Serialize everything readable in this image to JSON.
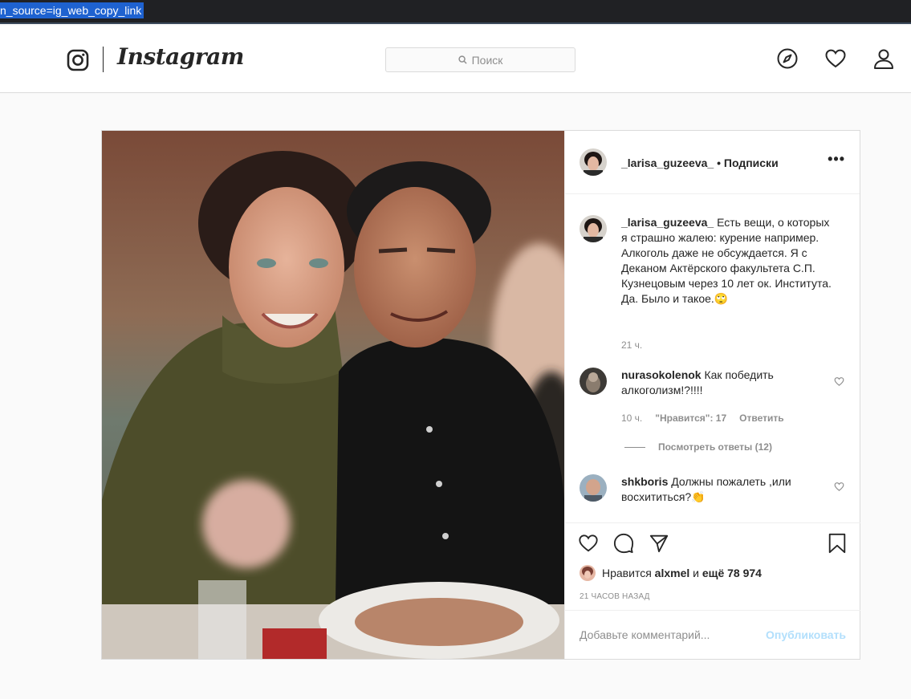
{
  "browser": {
    "url_fragment": "n_source=ig_web_copy_link"
  },
  "nav": {
    "wordmark": "Instagram",
    "search_placeholder": "Поиск",
    "icons": [
      "explore-icon",
      "heart-icon",
      "profile-icon"
    ]
  },
  "post": {
    "author": "_larisa_guzeeva_",
    "separator": "•",
    "follow_label": "Подписки",
    "more_label": "•••",
    "caption": {
      "username": "_larisa_guzeeva_",
      "text": "Есть вещи, о которых я страшно жалею: курение например. Алкоголь даже не обсуждается. Я с Деканом Актёрского факультета С.П. Кузнецовым через 10 лет ок. Института. Да. Было и такое.🙄",
      "time": "21 ч."
    },
    "comments": [
      {
        "username": "nurasokolenok",
        "text": "Как победить алкоголизм!?!!!!",
        "time": "10 ч.",
        "likes_label": "\"Нравится\": 17",
        "reply_label": "Ответить",
        "view_replies": "Посмотреть ответы (12)"
      },
      {
        "username": "shkboris",
        "text": "Должны пожалеть ,или восхититься?👏"
      }
    ],
    "likes": {
      "prefix": "Нравится",
      "user": "alxmel",
      "and": "и",
      "more": "ещё 78 974"
    },
    "timestamp": "21 ЧАСОВ НАЗАД",
    "add_comment_placeholder": "Добавьте комментарий...",
    "publish_label": "Опубликовать"
  }
}
